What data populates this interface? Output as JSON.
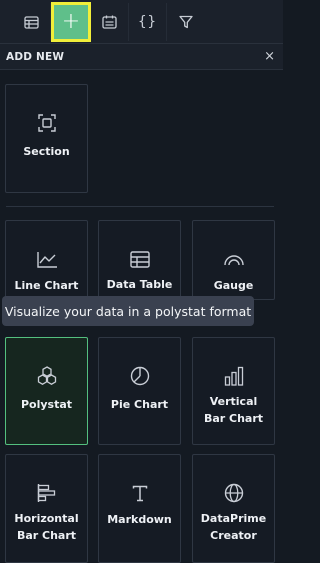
{
  "toolbar": {
    "buttons": [
      {
        "name": "widgets-button",
        "icon": "table-icon"
      },
      {
        "name": "add-new-button",
        "icon": "plus-icon",
        "glyph": "+",
        "active": true
      },
      {
        "name": "layout-button",
        "icon": "calendar-icon"
      },
      {
        "name": "json-button",
        "icon": "braces-icon",
        "glyph": "{}"
      },
      {
        "name": "filter-button",
        "icon": "filter-icon"
      }
    ]
  },
  "panel": {
    "title": "ADD NEW",
    "close_glyph": "×"
  },
  "section_card": {
    "label": "Section",
    "icon": "section-icon"
  },
  "widgets": [
    {
      "label": "Line Chart",
      "icon": "line-chart-icon"
    },
    {
      "label": "Data Table",
      "icon": "data-table-icon"
    },
    {
      "label": "Gauge",
      "icon": "gauge-icon"
    },
    {
      "label": "Polystat",
      "icon": "polystat-icon",
      "selected": true
    },
    {
      "label": "Pie Chart",
      "icon": "pie-chart-icon"
    },
    {
      "label": "Vertical\nBar Chart",
      "icon": "vertical-bar-chart-icon"
    },
    {
      "label": "Horizontal\nBar Chart",
      "icon": "horizontal-bar-chart-icon"
    },
    {
      "label": "Markdown",
      "icon": "markdown-icon"
    },
    {
      "label": "DataPrime\nCreator",
      "icon": "globe-icon"
    }
  ],
  "tooltip": {
    "text": "Visualize your data in a polystat format"
  },
  "colors": {
    "accent": "#5fbf8a",
    "highlight_border": "#f1ee3a",
    "selected_border": "#54bf7f",
    "background": "#141a22"
  }
}
